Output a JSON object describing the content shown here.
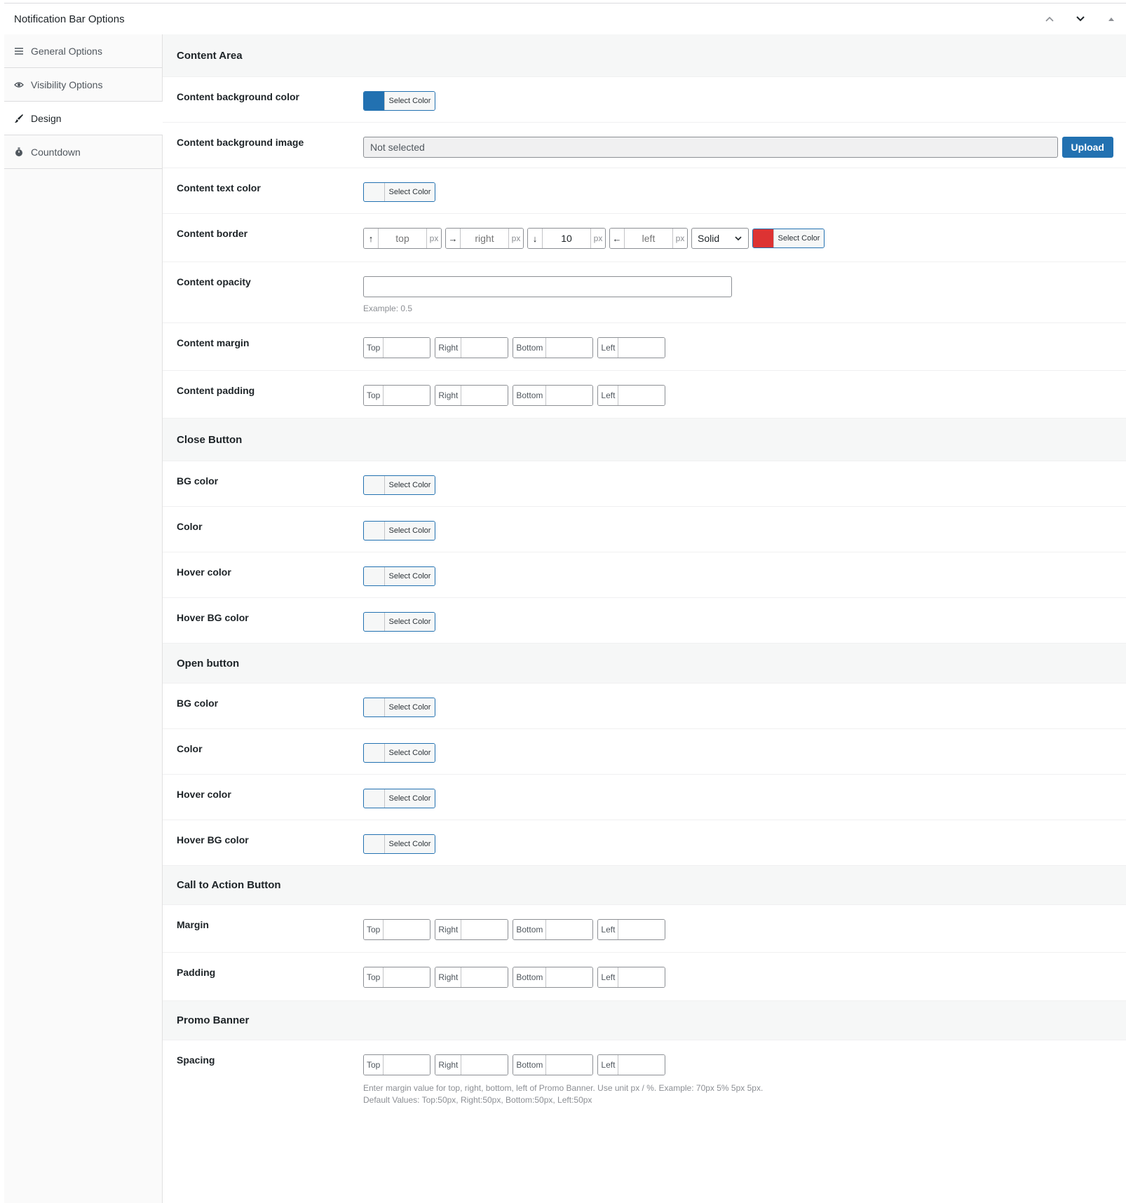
{
  "panel": {
    "title": "Notification Bar Options"
  },
  "sidebar": {
    "items": [
      {
        "label": "General Options",
        "icon": "list-icon"
      },
      {
        "label": "Visibility Options",
        "icon": "eye-icon"
      },
      {
        "label": "Design",
        "icon": "brush-icon",
        "active": true
      },
      {
        "label": "Countdown",
        "icon": "stopwatch-icon"
      }
    ]
  },
  "common": {
    "select_color": "Select Color",
    "top": "Top",
    "right": "Right",
    "bottom": "Bottom",
    "left": "Left",
    "px": "px"
  },
  "colors": {
    "accent": "#2271b1",
    "content_bg_swatch": "#2271b1",
    "border_swatch": "#dd3333"
  },
  "content_area": {
    "heading": "Content Area",
    "bg_color_label": "Content background color",
    "bg_image_label": "Content background image",
    "bg_image_value": "Not selected",
    "upload_label": "Upload",
    "text_color_label": "Content text color",
    "border_label": "Content border",
    "border": {
      "top_placeholder": "top",
      "right_placeholder": "right",
      "bottom_value": "10",
      "left_placeholder": "left",
      "style": "Solid"
    },
    "opacity_label": "Content opacity",
    "opacity_hint": "Example: 0.5",
    "margin_label": "Content margin",
    "padding_label": "Content padding"
  },
  "close_button": {
    "heading": "Close Button",
    "bg_color": "BG color",
    "color": "Color",
    "hover_color": "Hover color",
    "hover_bg_color": "Hover BG color"
  },
  "open_button": {
    "heading": "Open button",
    "bg_color": "BG color",
    "color": "Color",
    "hover_color": "Hover color",
    "hover_bg_color": "Hover BG color"
  },
  "cta_button": {
    "heading": "Call to Action Button",
    "margin": "Margin",
    "padding": "Padding"
  },
  "promo_banner": {
    "heading": "Promo Banner",
    "spacing": "Spacing",
    "hint_line1": "Enter margin value for top, right, bottom, left of Promo Banner. Use unit px / %. Example: 70px 5% 5px 5px.",
    "hint_line2": "Default Values: Top:50px, Right:50px, Bottom:50px, Left:50px"
  }
}
